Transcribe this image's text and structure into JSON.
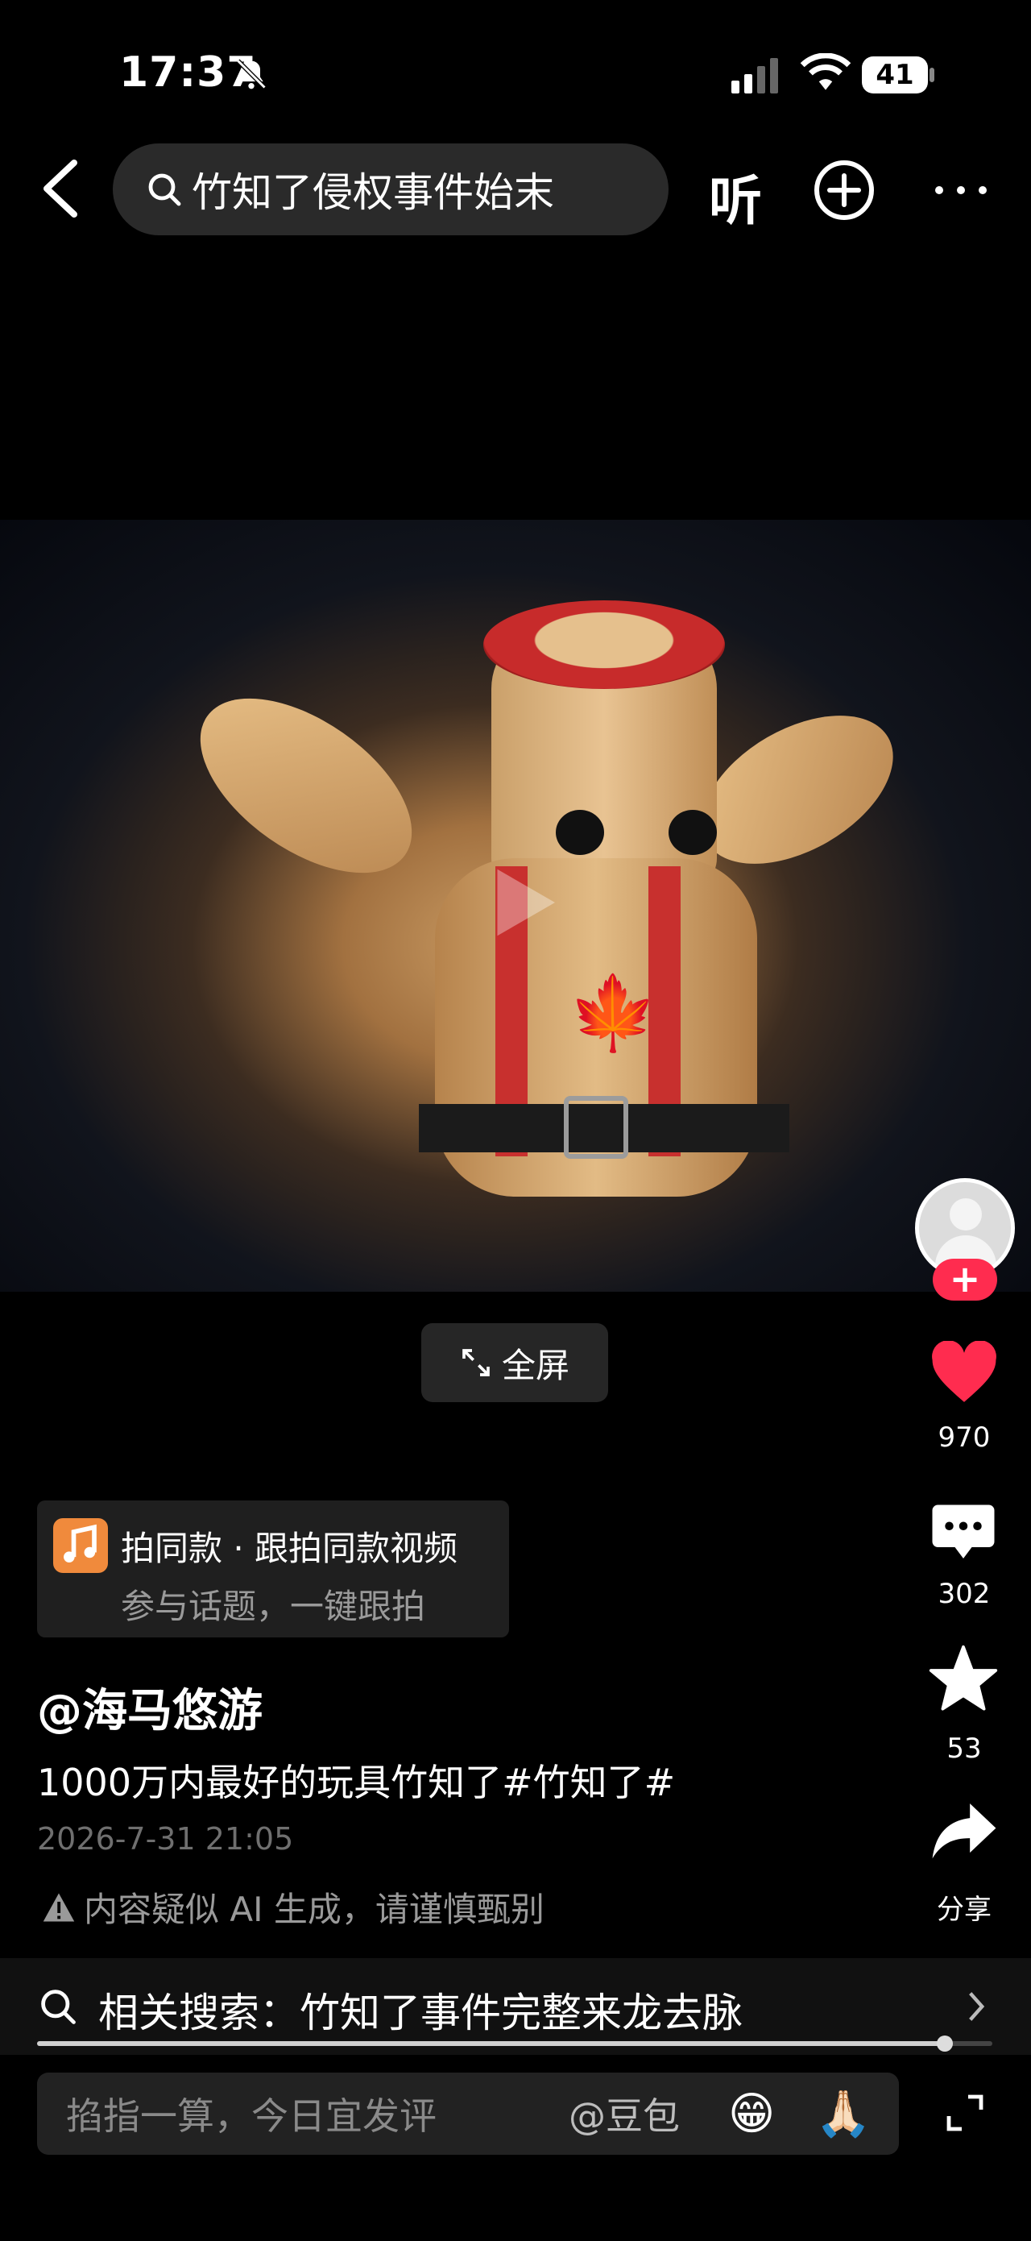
{
  "status_bar": {
    "time": "17:37",
    "battery": "41"
  },
  "top_bar": {
    "search_query": "竹知了侵权事件始末",
    "listen_label": "听"
  },
  "video": {
    "fullscreen_label": "全屏"
  },
  "actions": {
    "likes": "970",
    "comments": "302",
    "favorites": "53",
    "share_label": "分享",
    "follow_symbol": "+"
  },
  "template": {
    "title": "拍同款 · 跟拍同款视频",
    "subtitle": "参与话题，一键跟拍"
  },
  "post": {
    "author": "@海马悠游",
    "caption": "1000万内最好的玩具竹知了#竹知了#",
    "date": "2026-7-31 21:05",
    "ai_notice": "内容疑似 AI 生成，请谨慎甄别"
  },
  "related_search": {
    "text": "相关搜索：竹知了事件完整来龙去脉"
  },
  "playback": {
    "progress": 0.95
  },
  "comment_input": {
    "placeholder": "掐指一算，今日宜发评",
    "mention": "@豆包",
    "emoji_1": "😁",
    "emoji_2": "🙏🏻"
  },
  "colors": {
    "like": "#ff2c4f",
    "background": "#000000"
  }
}
